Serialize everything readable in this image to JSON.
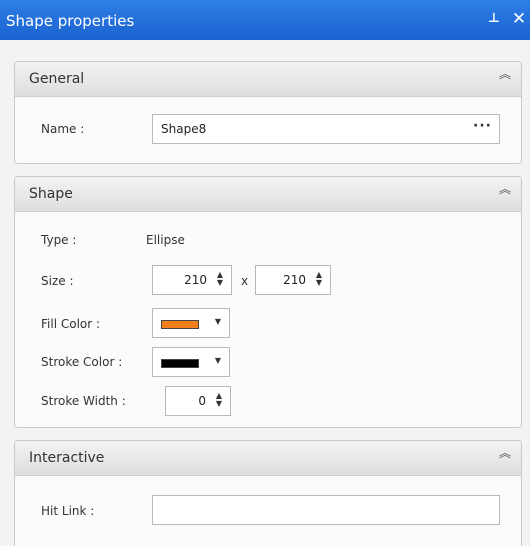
{
  "window": {
    "title": "Shape properties",
    "pin_glyph": "⊥",
    "close_glyph": "✕"
  },
  "panels": {
    "general": {
      "title": "General",
      "collapse_glyph": "︽",
      "name_label": "Name :",
      "name_value": "Shape8",
      "browse_glyph": "···"
    },
    "shape": {
      "title": "Shape",
      "collapse_glyph": "︽",
      "type_label": "Type :",
      "type_value": "Ellipse",
      "size_label": "Size :",
      "size_width": "210",
      "size_separator": "x",
      "size_height": "210",
      "fill_label": "Fill Color :",
      "fill_color": "#f07f1a",
      "stroke_label": "Stroke Color :",
      "stroke_color": "#000000",
      "stroke_width_label": "Stroke Width :",
      "stroke_width_value": "0"
    },
    "interactive": {
      "title": "Interactive",
      "collapse_glyph": "︽",
      "hitlink_label": "Hit Link :",
      "hitlink_value": ""
    }
  },
  "icons": {
    "spinner_up": "▲",
    "spinner_down": "▼",
    "dropdown": "▼"
  }
}
